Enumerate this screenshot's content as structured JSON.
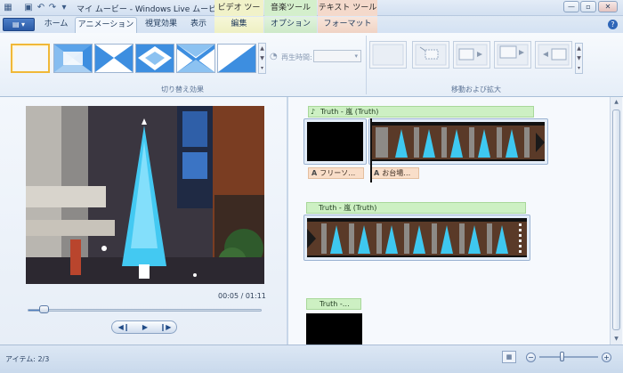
{
  "window": {
    "title": "マイ ムービー - Windows Live ムービー ...",
    "buttons": [
      "—",
      "▫",
      "✕"
    ]
  },
  "context_groups": {
    "video": "ビデオ ツール",
    "music": "音楽ツール",
    "text": "テキスト ツール"
  },
  "tabs": [
    {
      "label": "ホーム",
      "active": false
    },
    {
      "label": "アニメーション",
      "active": true
    },
    {
      "label": "視覚効果",
      "active": false
    },
    {
      "label": "表示",
      "active": false
    },
    {
      "label": "編集",
      "active": false
    },
    {
      "label": "オプション",
      "active": false
    },
    {
      "label": "フォーマット",
      "active": false
    }
  ],
  "ribbon": {
    "duration_label": "再生時間:",
    "duration_value": "▾",
    "transitions_group": "切り替え効果",
    "panzoom_group": "移動および拡大",
    "transition_names": [
      "none-transition",
      "diagonal-box-transition",
      "bow-tie-transition",
      "diamond-transition",
      "x-transition",
      "diagonal-wipe-transition"
    ],
    "panzoom_names": [
      "none-panzoom",
      "zoom-in-panzoom",
      "pan-right-panzoom",
      "pan-up-right-panzoom",
      "pan-left-panzoom"
    ]
  },
  "preview": {
    "time": "00:05 / 01:11",
    "position_fraction": 0.07,
    "controls": [
      "◀❙",
      "▶",
      "❙▶"
    ]
  },
  "storyboard": {
    "rows": [
      {
        "music_label": "Truth - 嵐 (Truth)",
        "captions": [
          {
            "label": "フリーソ…"
          },
          {
            "label": "お台場…"
          }
        ]
      },
      {
        "music_label": "Truth - 嵐 (Truth)",
        "captions": []
      },
      {
        "music_label": "Truth -…",
        "captions": []
      }
    ]
  },
  "status": {
    "items_text": "アイテム: 2/3",
    "zoom_out": "−",
    "zoom_in": "+",
    "zoom_level_fraction": 0.4
  },
  "colors": {
    "accent": "#2a5aa6",
    "music_bar": "#cdf0c3",
    "caption_bar": "#f9dec9",
    "selection": "#f0b838"
  }
}
